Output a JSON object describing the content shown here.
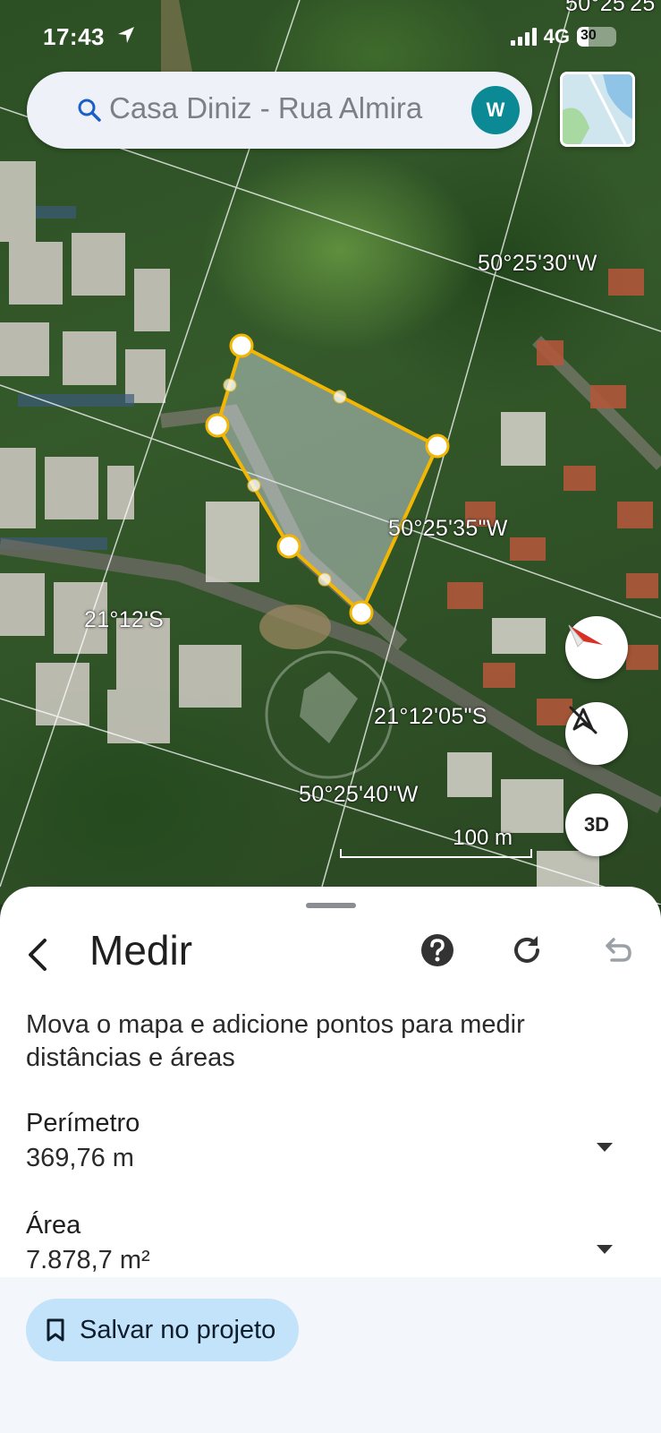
{
  "status_bar": {
    "time": "17:43",
    "network": "4G",
    "battery_text": "30",
    "battery_level_percent": 30
  },
  "search": {
    "text": "Casa Diniz - Rua Almira",
    "avatar_letter": "W"
  },
  "map": {
    "coordinate_labels": {
      "top_right_corner": "50°25'25",
      "lon_1": "50°25'30\"W",
      "lon_2": "50°25'35\"W",
      "lon_3": "50°25'40\"W",
      "lat_1": "21°12'S",
      "lat_2": "21°12'05\"S"
    },
    "scale_label": "100 m",
    "button_3d_label": "3D",
    "polygon_color": "#f2b705"
  },
  "sheet": {
    "title": "Medir",
    "instructions": "Mova o mapa e adicione pontos para medir distâncias e áreas",
    "perimeter_label": "Perímetro",
    "perimeter_value": "369,76 m",
    "area_label": "Área",
    "area_value": "7.878,7 m²",
    "save_label": "Salvar no projeto"
  },
  "icons": {
    "back": "chevron-left-icon",
    "help": "help-icon",
    "refresh": "refresh-icon",
    "undo": "undo-icon",
    "search": "search-icon",
    "compass": "compass-icon",
    "location": "location-off-icon",
    "bookmark": "bookmark-icon"
  },
  "colors": {
    "accent": "#0b8a95",
    "save_button_bg": "#c3e3fb",
    "sheet_footer_bg": "#f3f6fb"
  }
}
